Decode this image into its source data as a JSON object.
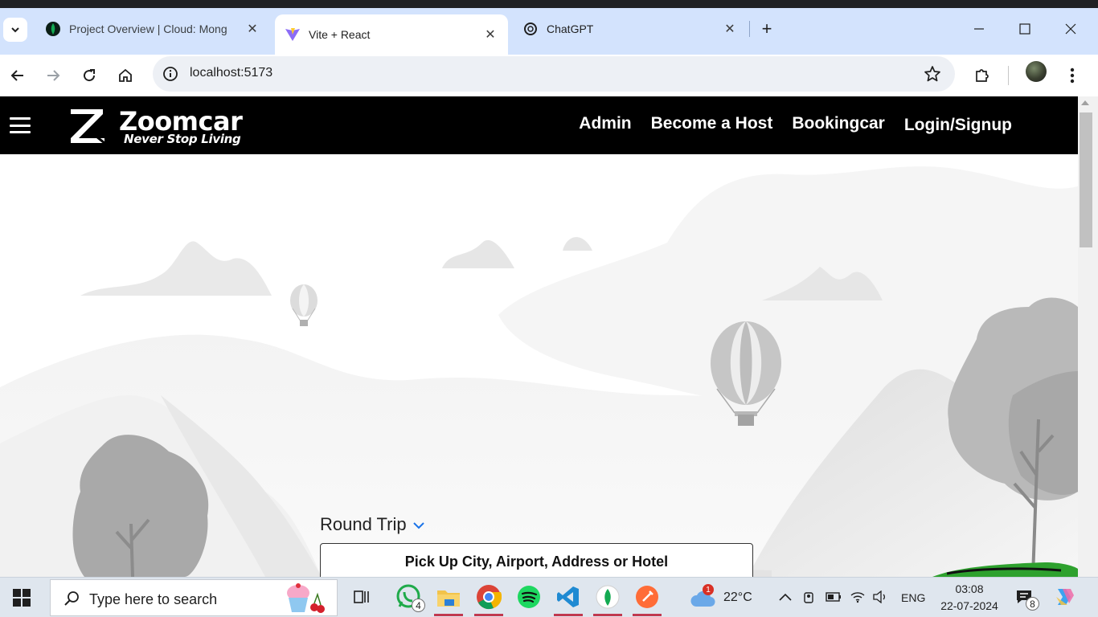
{
  "browser": {
    "tabs": [
      {
        "title": "Project Overview | Cloud: Mong",
        "favicon": "mongodb-leaf-icon",
        "active": false
      },
      {
        "title": "Vite + React",
        "favicon": "vite-icon",
        "active": true
      },
      {
        "title": "ChatGPT",
        "favicon": "chatgpt-icon",
        "active": false
      }
    ],
    "close_glyph": "✕",
    "new_tab_glyph": "+",
    "url": "localhost:5173"
  },
  "app": {
    "brand": "Zoomcar",
    "tagline": "Never Stop Living",
    "nav_links": [
      "Admin",
      "Become a Host",
      "Bookingcar",
      "Login/Signup"
    ],
    "trip_type": "Round Trip",
    "pickup_placeholder": "Pick Up City, Airport, Address or Hotel"
  },
  "taskbar": {
    "search_placeholder": "Type here to search",
    "whatsapp_badge": "4",
    "weather_temp": "22°C",
    "weather_alert": "1",
    "language": "ENG",
    "time": "03:08",
    "date": "22-07-2024",
    "notifications": "8"
  },
  "colors": {
    "tabstrip": "#d3e3fd",
    "navbar": "#000000",
    "taskbar": "#dfe6ee",
    "accent_chevron": "#1a73e8"
  }
}
